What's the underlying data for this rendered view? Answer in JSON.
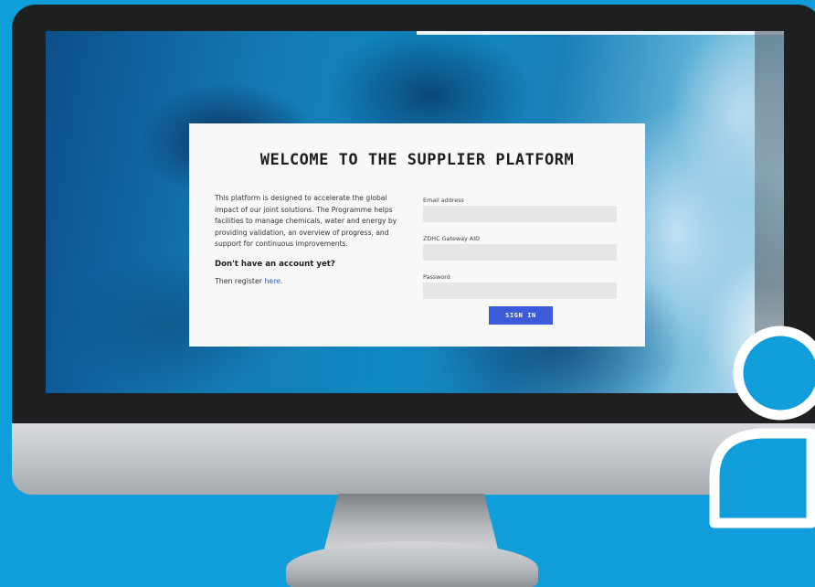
{
  "page": {
    "title": "WELCOME TO THE SUPPLIER PLATFORM",
    "intro": "This platform is designed to accelerate the global impact of our joint solutions. The Programme helps facilities to manage chemicals, water and energy by providing validation, an overview of progress, and support for continuous improvements.",
    "no_account": "Don't have an account yet?",
    "register_prefix": "Then register ",
    "register_link": "here",
    "register_suffix": "."
  },
  "form": {
    "email_label": "Email address",
    "email_value": "",
    "gateway_label": "ZDHC Gateway AID",
    "gateway_value": "",
    "password_label": "Password",
    "password_value": "",
    "signin_label": "SIGN IN"
  },
  "colors": {
    "page_background": "#0f9ed9",
    "button": "#3d5bd9",
    "link": "#2f62d6"
  },
  "icons": {
    "user": "user-icon"
  }
}
